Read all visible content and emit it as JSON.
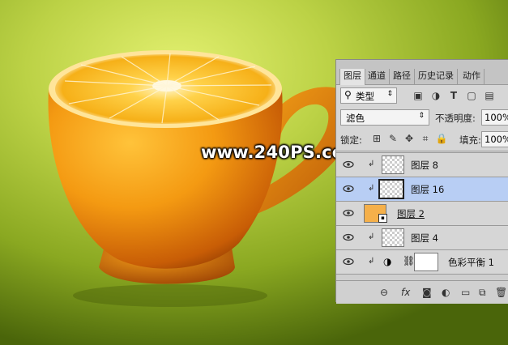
{
  "watermark": "www.240PS.com",
  "panel": {
    "tabs": [
      "图层",
      "通道",
      "路径",
      "历史记录",
      "动作"
    ],
    "filter_kind": "类型",
    "blend_mode": "滤色",
    "opacity_label": "不透明度:",
    "opacity_value": "100%",
    "lock_label": "锁定:",
    "fill_label": "填充:",
    "fill_value": "100%"
  },
  "layers": [
    {
      "name": "图层 8",
      "clipped": true,
      "selected": false,
      "type": "pixel"
    },
    {
      "name": "图层 16",
      "clipped": true,
      "selected": true,
      "type": "pixel"
    },
    {
      "name": "图层 2",
      "clipped": false,
      "selected": false,
      "type": "smart"
    },
    {
      "name": "图层 4",
      "clipped": true,
      "selected": false,
      "type": "pixel"
    },
    {
      "name": "色彩平衡 1",
      "clipped": true,
      "selected": false,
      "type": "adjustment"
    }
  ],
  "footer_icons": [
    "link-icon",
    "fx-icon",
    "mask-icon",
    "adjustment-icon",
    "group-icon",
    "new-layer-icon",
    "delete-icon"
  ],
  "colors": {
    "selected_row": "#b8cef4",
    "panel_bg": "#d6d6d6",
    "orange": "#f29a12",
    "background_green": "#b9d040"
  }
}
